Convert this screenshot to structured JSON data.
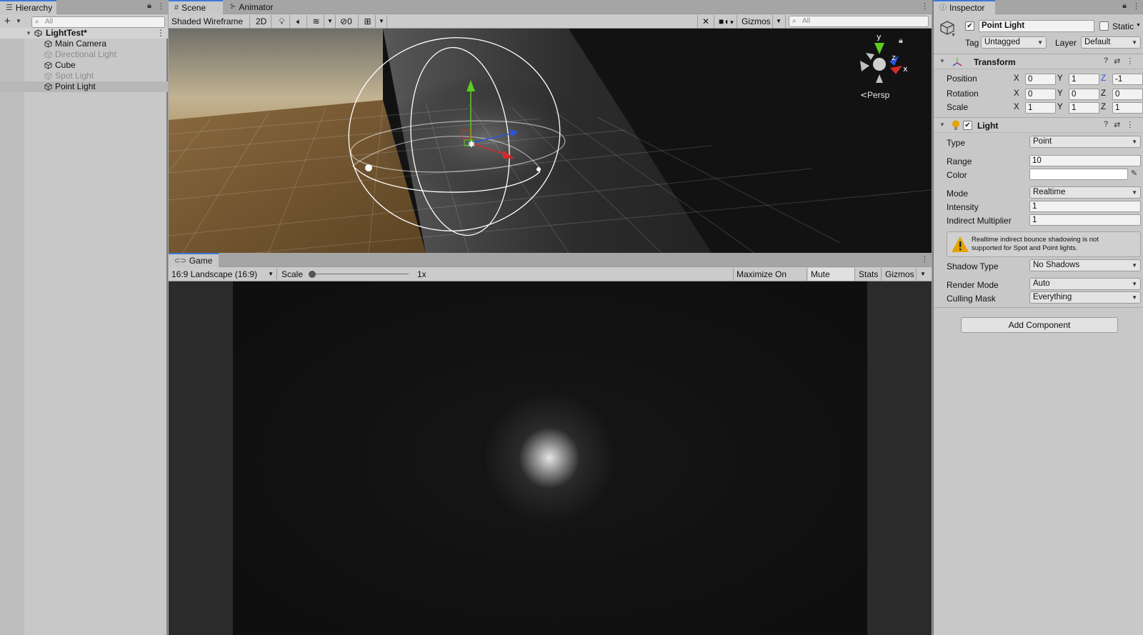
{
  "hierarchy": {
    "tab_label": "Hierarchy",
    "search_placeholder": "All",
    "scene_name": "LightTest*",
    "items": [
      {
        "label": "Main Camera",
        "enabled": true,
        "selected": false
      },
      {
        "label": "Directional Light",
        "enabled": false,
        "selected": false
      },
      {
        "label": "Cube",
        "enabled": true,
        "selected": false
      },
      {
        "label": "Spot Light",
        "enabled": false,
        "selected": false
      },
      {
        "label": "Point Light",
        "enabled": true,
        "selected": true
      }
    ]
  },
  "scene": {
    "tabs": [
      {
        "label": "Scene",
        "active": true
      },
      {
        "label": "Animator",
        "active": false
      }
    ],
    "draw_mode": "Shaded Wireframe",
    "btn_2d": "2D",
    "hidden_count": "0",
    "gizmos_label": "Gizmos",
    "search_placeholder": "All",
    "gizmo_axes": {
      "x": "x",
      "y": "y",
      "z": "z"
    },
    "projection_label": "Persp"
  },
  "game": {
    "tab_label": "Game",
    "aspect": "16:9 Landscape (16:9)",
    "scale_label": "Scale",
    "scale_value": "1x",
    "scale_slider_fraction": 0.0,
    "maximize_on_play": "Maximize On Play",
    "mute_audio": "Mute Audio",
    "stats": "Stats",
    "gizmos": "Gizmos"
  },
  "inspector": {
    "tab_label": "Inspector",
    "object_name": "Point Light",
    "active": true,
    "static_label": "Static",
    "tag_label": "Tag",
    "tag_value": "Untagged",
    "layer_label": "Layer",
    "layer_value": "Default",
    "transform": {
      "title": "Transform",
      "position": {
        "label": "Position",
        "x": "0",
        "y": "1",
        "z": "-1"
      },
      "rotation": {
        "label": "Rotation",
        "x": "0",
        "y": "0",
        "z": "0"
      },
      "scale": {
        "label": "Scale",
        "x": "1",
        "y": "1",
        "z": "1"
      }
    },
    "light": {
      "title": "Light",
      "enabled": true,
      "type_label": "Type",
      "type_value": "Point",
      "range_label": "Range",
      "range_value": "10",
      "color_label": "Color",
      "color_value": "#ffffff",
      "mode_label": "Mode",
      "mode_value": "Realtime",
      "intensity_label": "Intensity",
      "intensity_value": "1",
      "indirect_label": "Indirect Multiplier",
      "indirect_value": "1",
      "warning_line1": "Realtime indirect bounce shadowing is not",
      "warning_line2": "supported for Spot and Point lights.",
      "shadow_label": "Shadow Type",
      "shadow_value": "No Shadows",
      "render_label": "Render Mode",
      "render_value": "Auto",
      "culling_label": "Culling Mask",
      "culling_value": "Everything"
    },
    "add_component": "Add Component"
  },
  "colors": {
    "accent_tab": "#3a79d8",
    "axis_x": "#d12a2a",
    "axis_y": "#5ecb21",
    "axis_z": "#2a55d8",
    "warning": "#e2a400"
  }
}
